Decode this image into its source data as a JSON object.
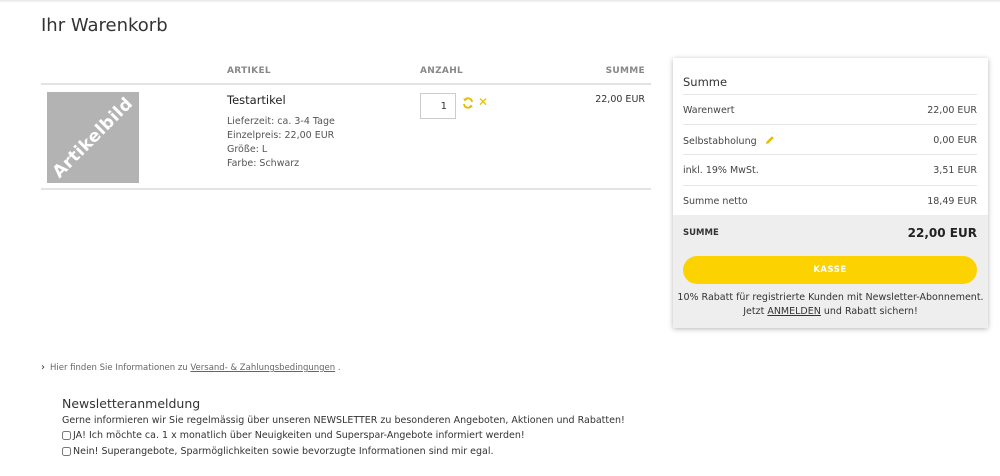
{
  "page": {
    "title": "Ihr Warenkorb"
  },
  "cart": {
    "columns": {
      "article": "ARTIKEL",
      "qty": "ANZAHL",
      "sum": "SUMME"
    },
    "items": [
      {
        "image_label": "Artikelbild",
        "name": "Testartikel",
        "details": [
          "Lieferzeit: ca. 3-4 Tage",
          "Einzelpreis: 22,00 EUR",
          "Größe: L",
          "Farbe: Schwarz"
        ],
        "quantity": "1",
        "sum": "22,00 EUR",
        "icons": {
          "update": "refresh-icon",
          "remove": "close-icon"
        }
      }
    ]
  },
  "summary": {
    "title": "Summe",
    "lines": [
      {
        "label": "Warenwert",
        "value": "22,00 EUR"
      },
      {
        "label": "Selbstabholung",
        "value": "0,00 EUR",
        "icon": "pencil-icon"
      },
      {
        "label": "inkl. 19% MwSt.",
        "value": "3,51 EUR"
      },
      {
        "label": "Summe netto",
        "value": "18,49 EUR"
      }
    ],
    "total_label": "SUMME",
    "total_value": "22,00 EUR",
    "checkout_label": "KASSE",
    "promo_line1": "10% Rabatt für registrierte Kunden mit Newsletter-Abonnement.",
    "promo_prefix": "Jetzt ",
    "promo_link": "ANMELDEN",
    "promo_suffix": " und Rabatt sichern!"
  },
  "info": {
    "prefix": "Hier finden Sie Informationen zu ",
    "link": "Versand- & Zahlungsbedingungen",
    "suffix": " ."
  },
  "newsletter": {
    "title": "Newsletteranmeldung",
    "text": "Gerne informieren wir Sie regelmässig über unseren NEWSLETTER zu besonderen Angeboten, Aktionen und Rabatten!",
    "option_yes": "JA! Ich möchte ca. 1 x monatlich über Neuigkeiten und Superspar-Angebote informiert werden!",
    "option_no": "Nein! Superangebote, Sparmöglichkeiten sowie bevorzugte Informationen sind mir egal."
  },
  "colors": {
    "accent": "#fcd200",
    "icon_yellow": "#e5bd00",
    "placeholder_gray": "#b3b3b3"
  }
}
